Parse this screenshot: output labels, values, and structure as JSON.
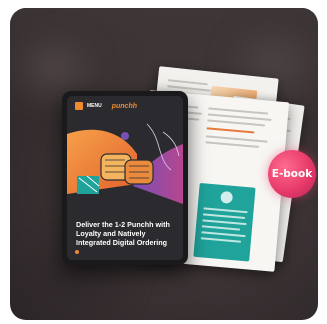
{
  "tablet": {
    "brand_left": "MENU",
    "brand_right": "punchh",
    "title": "Deliver the 1-2 Punchh with Loyalty and Natively Integrated Digital Ordering"
  },
  "badge": {
    "label": "E-book"
  },
  "colors": {
    "accent_orange": "#f08a2e",
    "badge_pink": "#e83b6a",
    "teal": "#1fa39a",
    "background": "#3a3233"
  },
  "icons": [
    "fist-bump-illustration",
    "ebook-badge"
  ]
}
